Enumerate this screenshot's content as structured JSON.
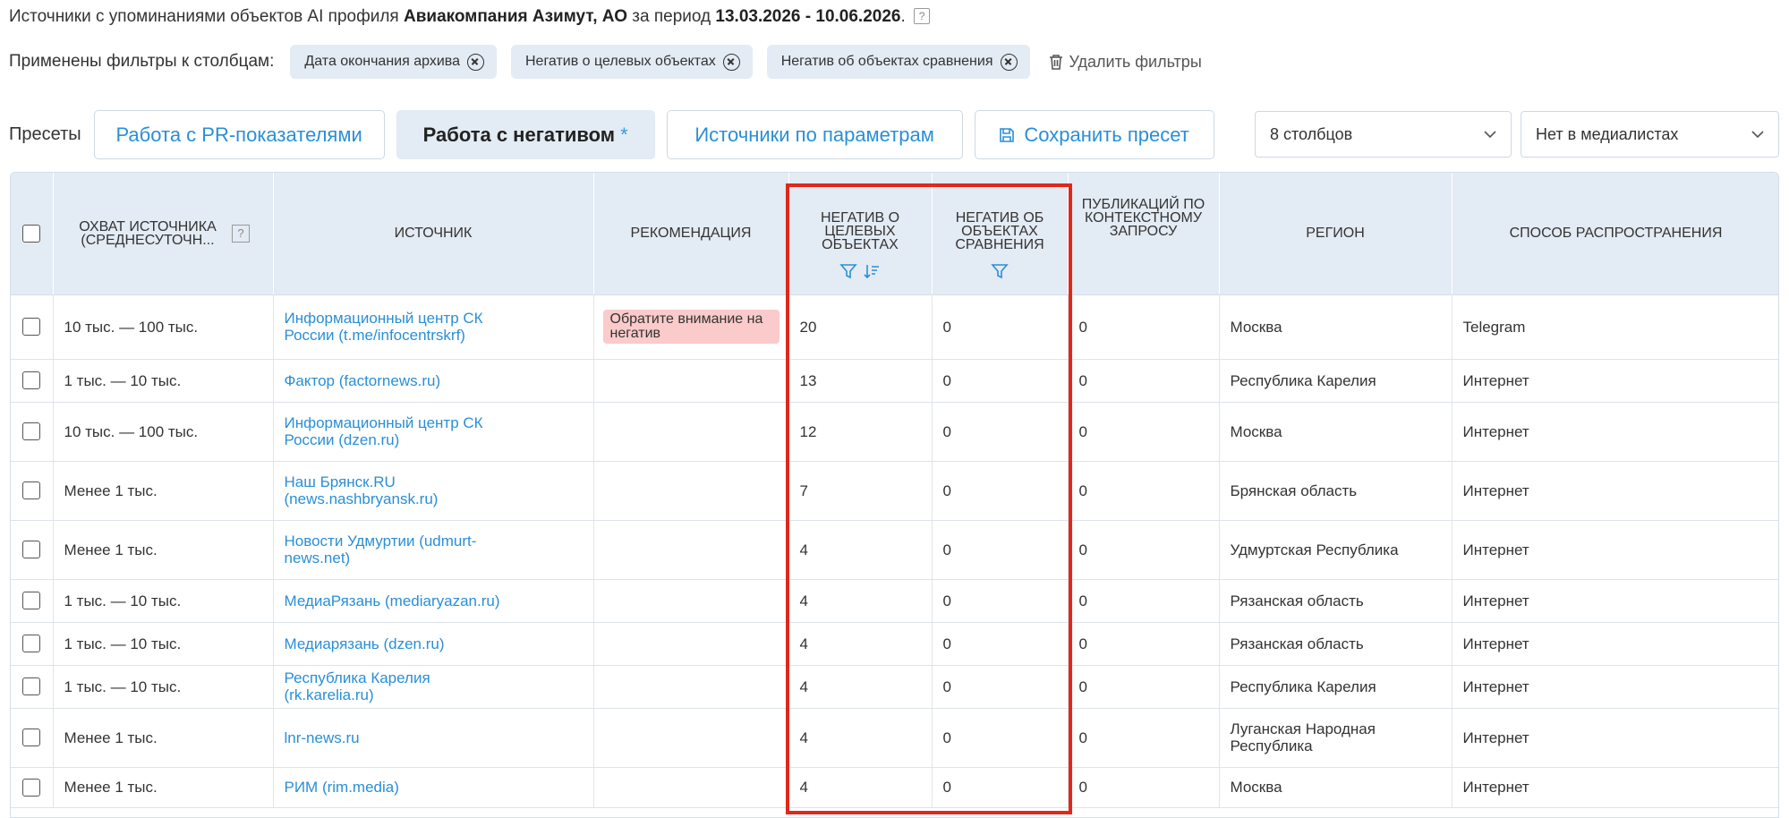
{
  "header": {
    "title_prefix": "Источники с упоминаниями объектов AI профиля ",
    "title_company": "Авиакомпания Азимут, АО",
    "title_period_prefix": " за период ",
    "title_period": "13.03.2026 - 10.06.2026",
    "title_suffix": ".",
    "help_mark": "?"
  },
  "filters": {
    "label": "Применены фильтры к столбцам:",
    "chips": [
      {
        "label": "Дата окончания архива"
      },
      {
        "label": "Негатив о целевых объектах"
      },
      {
        "label": "Негатив об объектах сравнения"
      }
    ],
    "clear_label": "Удалить фильтры"
  },
  "presets": {
    "label": "Пресеты",
    "buttons": [
      {
        "label": "Работа с PR-показателями",
        "active": false
      },
      {
        "label": "Работа с негативом",
        "active": true,
        "modified_mark": "*"
      },
      {
        "label": "Источники по параметрам",
        "active": false
      }
    ],
    "save_label": "Сохранить пресет",
    "columns_select": "8 столбцов",
    "media_select": "Нет в медиалистах"
  },
  "table": {
    "headers": {
      "reach": "Охват источника (среднесуточн...",
      "reach_help": "?",
      "source": "Источник",
      "recommendation": "Рекомендация",
      "neg_target": "Негатив о целевых объектах",
      "neg_compare": "Негатив об объектах сравнения",
      "publications": "Публикаций по контекстному запросу",
      "region": "Регион",
      "method": "Способ распространения"
    },
    "rows": [
      {
        "reach": "10 тыс. — 100 тыс.",
        "source": "Информационный центр СК России (t.me/infocentrskrf)",
        "recommendation": "Обратите внимание на негатив",
        "neg_target": "20",
        "neg_compare": "0",
        "publications": "0",
        "region": "Москва",
        "method": "Telegram"
      },
      {
        "reach": "1 тыс. — 10 тыс.",
        "source": "Фактор (factornews.ru)",
        "recommendation": "",
        "neg_target": "13",
        "neg_compare": "0",
        "publications": "0",
        "region": "Республика Карелия",
        "method": "Интернет"
      },
      {
        "reach": "10 тыс. — 100 тыс.",
        "source": "Информационный центр СК России (dzen.ru)",
        "recommendation": "",
        "neg_target": "12",
        "neg_compare": "0",
        "publications": "0",
        "region": "Москва",
        "method": "Интернет"
      },
      {
        "reach": "Менее 1 тыс.",
        "source": "Наш Брянск.RU (news.nashbryansk.ru)",
        "recommendation": "",
        "neg_target": "7",
        "neg_compare": "0",
        "publications": "0",
        "region": "Брянская область",
        "method": "Интернет"
      },
      {
        "reach": "Менее 1 тыс.",
        "source": "Новости Удмуртии (udmurt-news.net)",
        "recommendation": "",
        "neg_target": "4",
        "neg_compare": "0",
        "publications": "0",
        "region": "Удмуртская Республика",
        "method": "Интернет"
      },
      {
        "reach": "1 тыс. — 10 тыс.",
        "source": "МедиаРязань (mediaryazan.ru)",
        "recommendation": "",
        "neg_target": "4",
        "neg_compare": "0",
        "publications": "0",
        "region": "Рязанская область",
        "method": "Интернет"
      },
      {
        "reach": "1 тыс. — 10 тыс.",
        "source": "Медиарязань (dzen.ru)",
        "recommendation": "",
        "neg_target": "4",
        "neg_compare": "0",
        "publications": "0",
        "region": "Рязанская область",
        "method": "Интернет"
      },
      {
        "reach": "1 тыс. — 10 тыс.",
        "source": "Республика Карелия (rk.karelia.ru)",
        "recommendation": "",
        "neg_target": "4",
        "neg_compare": "0",
        "publications": "0",
        "region": "Республика Карелия",
        "method": "Интернет"
      },
      {
        "reach": "Менее 1 тыс.",
        "source": "lnr-news.ru",
        "recommendation": "",
        "neg_target": "4",
        "neg_compare": "0",
        "publications": "0",
        "region": "Луганская Народная Республика",
        "method": "Интернет"
      },
      {
        "reach": "Менее 1 тыс.",
        "source": "РИМ (rim.media)",
        "recommendation": "",
        "neg_target": "4",
        "neg_compare": "0",
        "publications": "0",
        "region": "Москва",
        "method": "Интернет"
      }
    ]
  },
  "colors": {
    "accent": "#2a8fd6",
    "header_bg": "#e3ebf4",
    "highlight": "#e0281c",
    "badge_bg": "#fbcaca"
  },
  "icons": [
    "help-icon",
    "close-circle-icon",
    "trash-icon",
    "save-icon",
    "chevron-down-icon",
    "filter-icon",
    "sort-desc-icon",
    "checkbox-icon"
  ]
}
